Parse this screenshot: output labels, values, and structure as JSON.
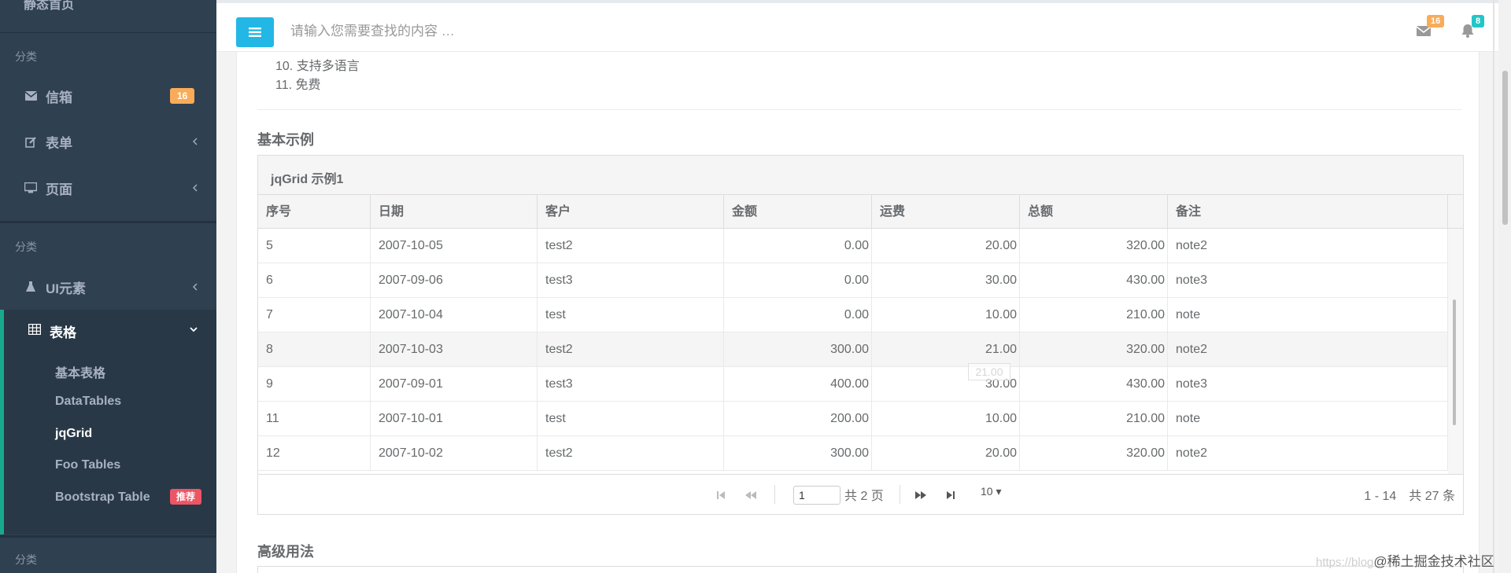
{
  "sidebar": {
    "top_label": "静态首页",
    "category_label": "分类",
    "items": [
      {
        "label": "信箱",
        "badge": "16",
        "icon": "envelope-icon"
      },
      {
        "label": "表单",
        "icon": "edit-icon"
      },
      {
        "label": "页面",
        "icon": "desktop-icon"
      },
      {
        "label": "UI元素",
        "icon": "flask-icon"
      }
    ],
    "active": {
      "label": "表格",
      "icon": "table-icon",
      "children": [
        {
          "label": "基本表格"
        },
        {
          "label": "DataTables"
        },
        {
          "label": "jqGrid"
        },
        {
          "label": "Foo Tables"
        },
        {
          "label": "Bootstrap Table",
          "badge": "推荐"
        }
      ]
    }
  },
  "navbar": {
    "search_placeholder": "请输入您需要查找的内容 …",
    "mail_badge": "16",
    "bell_badge": "8"
  },
  "content": {
    "features": [
      "10. 支持多语言",
      "11. 免费"
    ],
    "section_basic": "基本示例",
    "section_advanced": "高级用法",
    "grid": {
      "caption": "jqGrid 示例1",
      "columns": [
        "序号",
        "日期",
        "客户",
        "金额",
        "运费",
        "总额",
        "备注"
      ],
      "rows": [
        [
          "5",
          "2007-10-05",
          "test2",
          "0.00",
          "20.00",
          "320.00",
          "note2"
        ],
        [
          "6",
          "2007-09-06",
          "test3",
          "0.00",
          "30.00",
          "430.00",
          "note3"
        ],
        [
          "7",
          "2007-10-04",
          "test",
          "0.00",
          "10.00",
          "210.00",
          "note"
        ],
        [
          "8",
          "2007-10-03",
          "test2",
          "300.00",
          "21.00",
          "320.00",
          "note2"
        ],
        [
          "9",
          "2007-09-01",
          "test3",
          "400.00",
          "30.00",
          "430.00",
          "note3"
        ],
        [
          "11",
          "2007-10-01",
          "test",
          "200.00",
          "10.00",
          "210.00",
          "note"
        ],
        [
          "12",
          "2007-10-02",
          "test2",
          "300.00",
          "20.00",
          "320.00",
          "note2"
        ]
      ],
      "tooltip": "21.00",
      "pager": {
        "page_value": "1",
        "total_pages": "共 2 页",
        "page_size": "10 ▾",
        "info": "1 - 14　共 27 条"
      }
    }
  },
  "watermark": {
    "url": "https://blog",
    "text": "@稀土掘金技术社区"
  },
  "colors": {
    "sidebar": "#2f4050",
    "accent": "#19aa8d",
    "menu_button": "#23b7e5",
    "badge_orange": "#f8ac59",
    "badge_red": "#ed5565",
    "badge_blue": "#23c6c8"
  }
}
